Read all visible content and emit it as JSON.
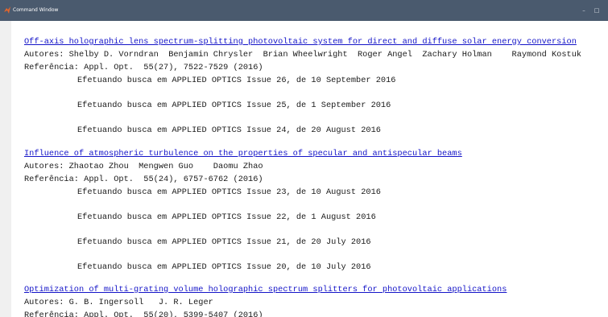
{
  "window": {
    "title": "Command Window",
    "minimize_glyph": "–",
    "maximize_glyph": "□"
  },
  "lines": [
    "Off-axis holographic lens spectrum-splitting photovoltaic system for direct and diffuse solar energy conversion",
    "Autores: Shelby D. Vorndran  Benjamin Chrysler  Brian Wheelwright  Roger Angel  Zachary Holman    Raymond Kostuk",
    "Referência: Appl. Opt.  55(27), 7522-7529 (2016)",
    "Efetuando busca em APPLIED OPTICS Issue 26, de 10 September 2016",
    "Efetuando busca em APPLIED OPTICS Issue 25, de 1 September 2016",
    "Efetuando busca em APPLIED OPTICS Issue 24, de 20 August 2016",
    "Influence of atmospheric turbulence on the properties of specular and antispecular beams",
    "Autores: Zhaotao Zhou  Mengwen Guo    Daomu Zhao",
    "Referência: Appl. Opt.  55(24), 6757-6762 (2016)",
    "Efetuando busca em APPLIED OPTICS Issue 23, de 10 August 2016",
    "Efetuando busca em APPLIED OPTICS Issue 22, de 1 August 2016",
    "Efetuando busca em APPLIED OPTICS Issue 21, de 20 July 2016",
    "Efetuando busca em APPLIED OPTICS Issue 20, de 10 July 2016",
    "Optimization of multi-grating volume holographic spectrum splitters for photovoltaic applications",
    "Autores: G. B. Ingersoll   J. R. Leger",
    "Referência: Appl. Opt.  55(20), 5399-5407 (2016)"
  ]
}
